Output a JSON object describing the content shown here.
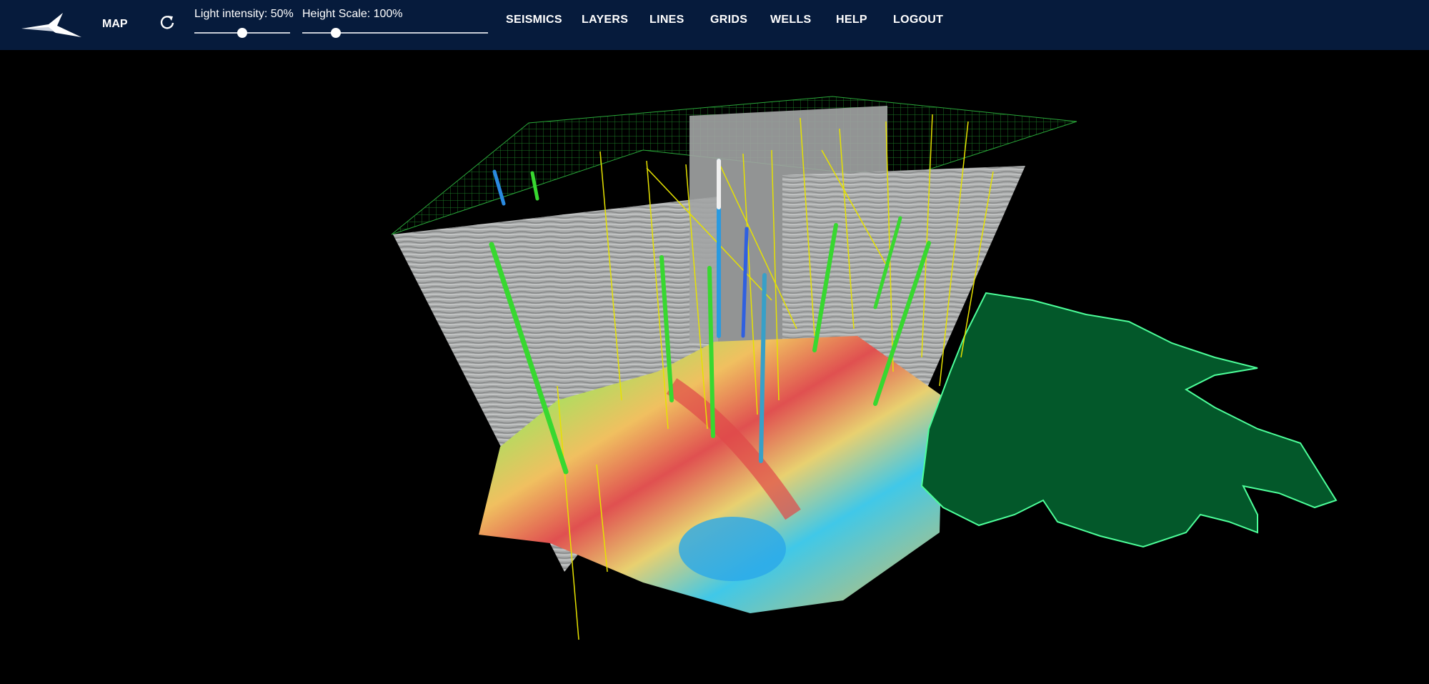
{
  "header": {
    "logo_icon": "kongsberg-logo-icon",
    "map_label": "MAP",
    "refresh_icon": "refresh-icon",
    "light": {
      "label": "Light intensity: 50%",
      "value": 0.5
    },
    "height": {
      "label": "Height Scale: 100%",
      "value": 0.14
    },
    "nav": [
      "SEISMICS",
      "LAYERS",
      "LINES",
      "GRIDS",
      "WELLS",
      "HELP",
      "LOGOUT"
    ]
  },
  "colors": {
    "header_bg": "#061b3c",
    "viewport_bg": "#000000",
    "outline_fill": "#03582a",
    "outline_stroke": "#4dff9a",
    "seismic_panel": "#a9abab",
    "well_line": "#e6e200"
  }
}
